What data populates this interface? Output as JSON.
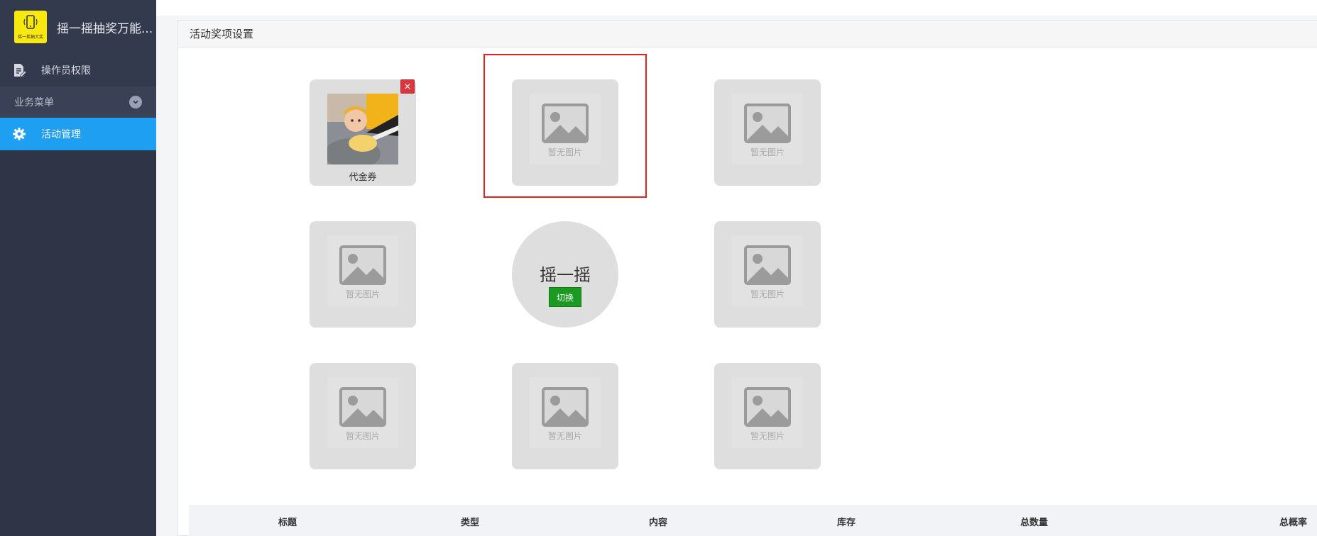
{
  "app": {
    "title": "摇一摇抽奖万能...",
    "logo_text": "摇一摇抽大奖",
    "brand_color": "#f7e80d"
  },
  "sidebar": {
    "items": [
      {
        "label": "操作员权限",
        "icon": "document-edit-icon"
      },
      {
        "label": "业务菜单",
        "icon": "chevron-down-icon"
      },
      {
        "label": "活动管理",
        "icon": "gear-icon",
        "active": true
      }
    ],
    "active_color": "#1e9ff2"
  },
  "panel": {
    "title": "活动奖项设置"
  },
  "prizes": {
    "tile1_label": "代金券",
    "delete_label": "×",
    "placeholder_text": "暂无图片"
  },
  "center": {
    "title": "摇一摇",
    "switch_label": "切换"
  },
  "table": {
    "columns": [
      "标题",
      "类型",
      "内容",
      "库存",
      "总数量",
      "总概率"
    ]
  }
}
